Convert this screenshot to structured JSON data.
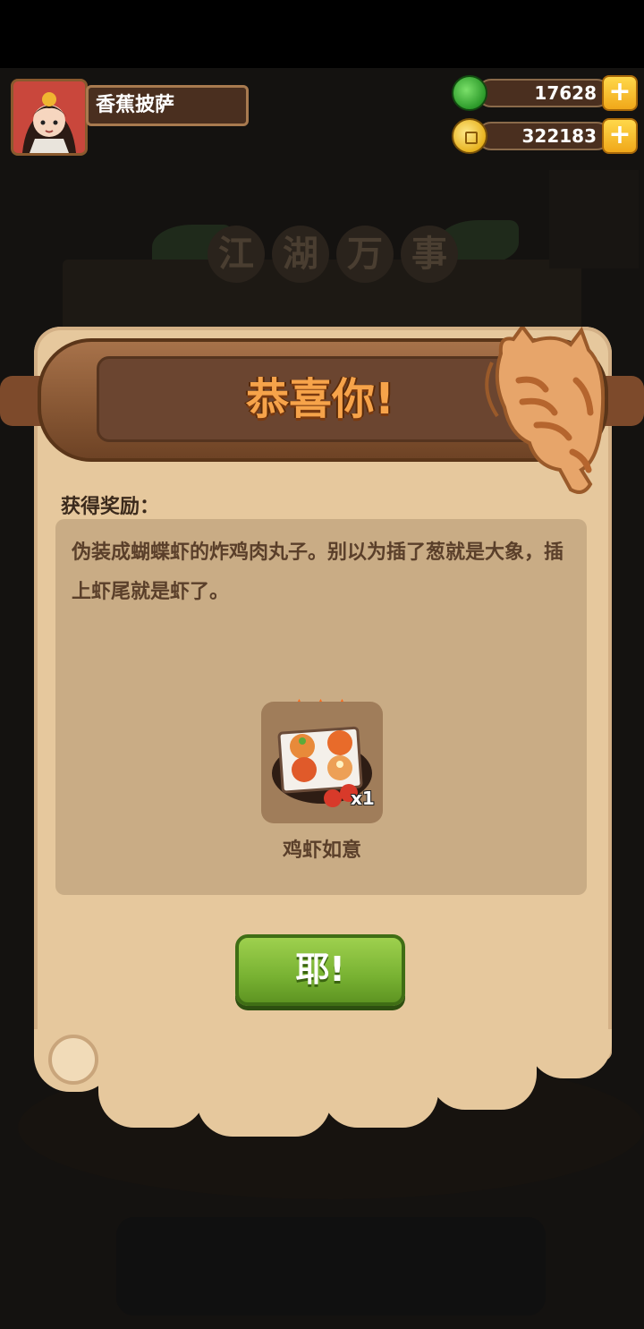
{
  "player": {
    "name": "香蕉披萨"
  },
  "resources": {
    "jade": "17628",
    "coins": "322183",
    "plus": "+"
  },
  "background": {
    "title_chars": [
      "江",
      "湖",
      "万",
      "事"
    ]
  },
  "dialog": {
    "title": "恭喜你!",
    "reward_label": "获得奖励：",
    "description": "伪装成蝴蝶虾的炸鸡肉丸子。别以为插了葱就是大象，插上虾尾就是虾了。",
    "item": {
      "name": "鸡虾如意",
      "quantity": "x1",
      "stars": 3
    },
    "confirm_label": "耶!"
  },
  "colors": {
    "parchment": "#e6c89d",
    "content_box": "#c9ac85",
    "title_text": "#f6a34a",
    "button_green": "#78b232"
  }
}
